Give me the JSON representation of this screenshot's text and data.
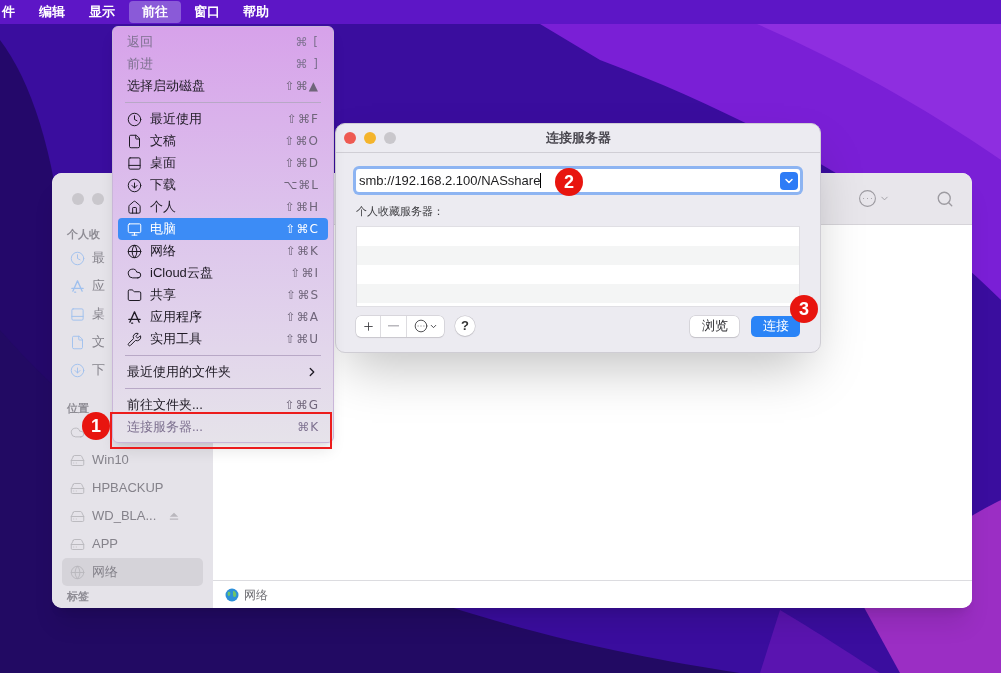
{
  "menu_bar": {
    "items": [
      {
        "label": "件",
        "selected": false
      },
      {
        "label": "编辑",
        "selected": false
      },
      {
        "label": "显示",
        "selected": false
      },
      {
        "label": "前往",
        "selected": true
      },
      {
        "label": "窗口",
        "selected": false
      },
      {
        "label": "帮助",
        "selected": false
      }
    ]
  },
  "go_menu": {
    "sections": [
      {
        "items": [
          {
            "kind": "command",
            "label": "返回",
            "shortcut": "⌘ [",
            "disabled": true,
            "selected": false
          },
          {
            "kind": "command",
            "label": "前进",
            "shortcut": "⌘ ]",
            "disabled": true,
            "selected": false
          },
          {
            "kind": "command",
            "label": "选择启动磁盘",
            "shortcut": "⇧⌘▲",
            "disabled": false,
            "selected": false
          }
        ]
      },
      {
        "items": [
          {
            "kind": "place",
            "label": "最近使用",
            "shortcut": "⇧⌘F",
            "disabled": false,
            "selected": false
          },
          {
            "kind": "place",
            "label": "文稿",
            "shortcut": "⇧⌘O",
            "disabled": false,
            "selected": false
          },
          {
            "kind": "place",
            "label": "桌面",
            "shortcut": "⇧⌘D",
            "disabled": false,
            "selected": false
          },
          {
            "kind": "place",
            "label": "下载",
            "shortcut": "⌥⌘L",
            "disabled": false,
            "selected": false
          },
          {
            "kind": "place",
            "label": "个人",
            "shortcut": "⇧⌘H",
            "disabled": false,
            "selected": false
          },
          {
            "kind": "place",
            "label": "电脑",
            "shortcut": "⇧⌘C",
            "disabled": false,
            "selected": true
          },
          {
            "kind": "place",
            "label": "网络",
            "shortcut": "⇧⌘K",
            "disabled": false,
            "selected": false
          },
          {
            "kind": "place",
            "label": "iCloud云盘",
            "shortcut": "⇧⌘I",
            "disabled": false,
            "selected": false
          },
          {
            "kind": "place",
            "label": "共享",
            "shortcut": "⇧⌘S",
            "disabled": false,
            "selected": false
          },
          {
            "kind": "place",
            "label": "应用程序",
            "shortcut": "⇧⌘A",
            "disabled": false,
            "selected": false
          },
          {
            "kind": "place",
            "label": "实用工具",
            "shortcut": "⇧⌘U",
            "disabled": false,
            "selected": false
          }
        ]
      },
      {
        "items": [
          {
            "kind": "submenu",
            "label": "最近使用的文件夹",
            "disabled": false,
            "selected": false
          }
        ]
      },
      {
        "items": [
          {
            "kind": "command",
            "label": "前往文件夹...",
            "shortcut": "⇧⌘G",
            "disabled": false,
            "selected": false
          },
          {
            "kind": "command",
            "label": "连接服务器...",
            "shortcut": "⌘K",
            "disabled": true,
            "selected": false,
            "callout": "1"
          }
        ]
      }
    ]
  },
  "finder": {
    "sidebar": {
      "sections": [
        {
          "heading": "个人收",
          "items": [
            {
              "label": "最",
              "selected": false
            },
            {
              "label": "应",
              "selected": false
            },
            {
              "label": "桌",
              "selected": false
            },
            {
              "label": "文",
              "selected": false
            },
            {
              "label": "下",
              "selected": false
            }
          ]
        },
        {
          "heading": "位置",
          "items": [
            {
              "selected": false
            },
            {
              "label": "Win10",
              "selected": false
            },
            {
              "label": "HPBACKUP",
              "selected": false
            },
            {
              "label": "WD_BLA...",
              "selected": false,
              "eject": true
            },
            {
              "label": "APP",
              "selected": false
            },
            {
              "label": "网络",
              "selected": true
            }
          ]
        },
        {
          "heading": "标签"
        }
      ]
    },
    "status_bar": {
      "path": "网络"
    }
  },
  "connect_dialog": {
    "title": "连接服务器",
    "server_field": {
      "value": "smb://192.168.2.100/NASshare",
      "focused": true,
      "callout": "2"
    },
    "favorites_label": "个人收藏服务器：",
    "help": "?",
    "buttons": [
      {
        "label": "浏览",
        "primary": false
      },
      {
        "label": "连接",
        "primary": true,
        "callout": "3"
      }
    ]
  }
}
